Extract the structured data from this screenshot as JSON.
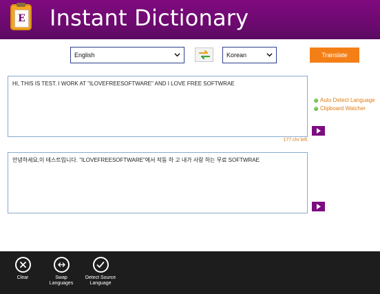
{
  "app": {
    "title": "Instant Dictionary",
    "logo_letter": "E"
  },
  "toolbar": {
    "source_language": "English",
    "target_language": "Korean",
    "translate_label": "Translate"
  },
  "input": {
    "text": "HI, THIS IS TEST. I WORK AT \"ILOVEFREESOFTWARE\" AND I LOVE FREE SOFTWRAE",
    "chars_left": "177 chr left."
  },
  "output": {
    "text": "안녕하세요,이 테스트입니다. \"ILOVEFREESOFTWARE\"에서 작동 하 고 내가 사랑 하는 무료 SOFTWRAE"
  },
  "options": {
    "auto_detect": "Auto Detect Language",
    "clipboard_watcher": "Clipboard Watcher"
  },
  "appbar": {
    "clear": "Clear",
    "swap": "Swap Languages",
    "detect": "Detect Source Language"
  },
  "colors": {
    "header": "#6d0a70",
    "accent": "#f57f17",
    "play_button": "#7d0d80",
    "appbar": "#1d1d1d"
  }
}
